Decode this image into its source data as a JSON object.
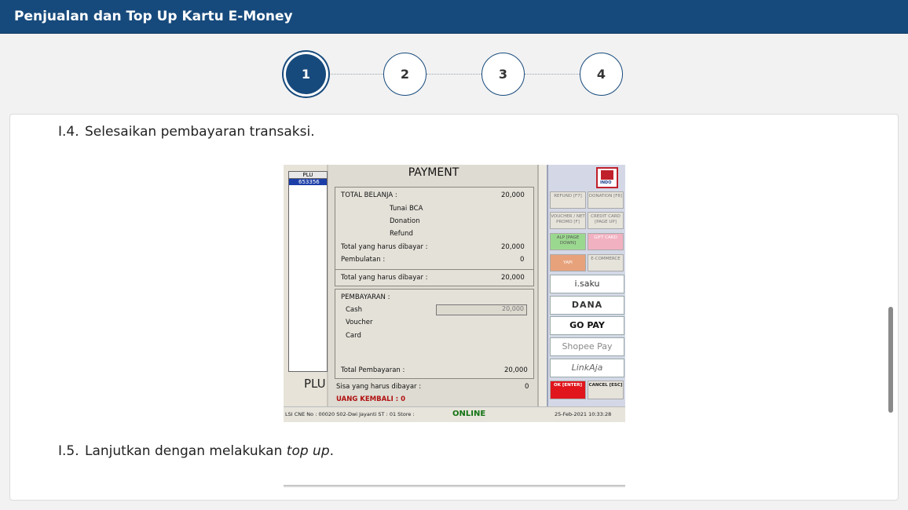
{
  "header": {
    "title": "Penjualan dan Top Up Kartu E-Money"
  },
  "stepper": {
    "steps": [
      "1",
      "2",
      "3",
      "4"
    ],
    "active_step": "1"
  },
  "content": {
    "step_14": {
      "num": "I.4.",
      "text": "Selesaikan pembayaran transaksi."
    },
    "step_15": {
      "num": "I.5.",
      "text_before": "Lanjutkan dengan melakukan ",
      "text_italic": "top up",
      "text_after": "."
    }
  },
  "pos_screenshot": {
    "plu_header": "PLU",
    "plu_row": "653356",
    "plu_big": "PLU",
    "title": "PAYMENT",
    "total_belanja_label": "TOTAL BELANJA :",
    "total_belanja_value": "20,000",
    "tunai_bca": "Tunai BCA",
    "donation": "Donation",
    "refund": "Refund",
    "total_harus_label": "Total yang harus dibayar :",
    "total_harus_value": "20,000",
    "pembulatan_label": "Pembulatan :",
    "pembulatan_value": "0",
    "total_harus2_label": "Total yang harus dibayar :",
    "total_harus2_value": "20,000",
    "pembayaran_label": "PEMBAYARAN :",
    "cash_label": "Cash",
    "cash_value": "20,000",
    "voucher_label": "Voucher",
    "card_label": "Card",
    "total_pembayaran_label": "Total Pembayaran :",
    "total_pembayaran_value": "20,000",
    "sisa_label": "Sisa yang harus dibayar :",
    "sisa_value": "0",
    "uang_kembali": "UANG KEMBALI : 0",
    "status_left": "LSI CNE  No : 00020  S02-Dwi Jayanti  ST : 01  Store :",
    "status_online": "ONLINE",
    "status_date": "25-Feb-2021 10:33:28",
    "logo_text": "INDO",
    "buttons": {
      "refund": "REFUND [F7]",
      "donation": "DONATION [F8]",
      "voucher": "VOUCHER / NET PROMO [F]",
      "credit": "CREDIT CARD [PAGE UP]",
      "alp": "ALP [PAGE DOWN]",
      "gift": "GIFT CARD",
      "yapi": "YAPI",
      "ecommerce": "E-COMMERCE",
      "isaku": "i.saku",
      "dana": "DANA",
      "gopay": "GO PAY",
      "shopeepay": "Shopee Pay",
      "linkaja": "LinkAja",
      "ok": "OK [ENTER]",
      "cancel": "CANCEL [ESC]"
    }
  },
  "colors": {
    "primary": "#174a7c",
    "ok_red": "#e0161c",
    "online_green": "#137313"
  }
}
